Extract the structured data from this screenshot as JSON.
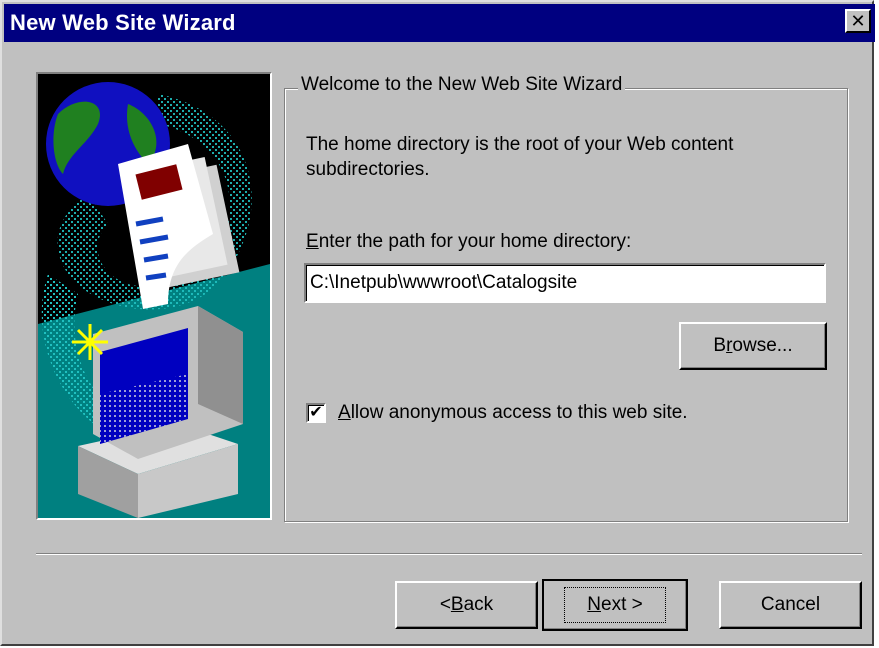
{
  "window": {
    "title": "New Web Site Wizard",
    "close_glyph": "✕"
  },
  "group": {
    "title": "Welcome to the New Web Site Wizard",
    "description": "The home directory is the root of your Web content subdirectories."
  },
  "path": {
    "label_accel": "E",
    "label_rest": "nter the path for your home directory:",
    "value": "C:\\Inetpub\\wwwroot\\Catalogsite"
  },
  "browse_button": {
    "pre": "B",
    "accel": "r",
    "post": "owse..."
  },
  "anonymous_access": {
    "checked": true,
    "check_glyph": "✔",
    "accel": "A",
    "rest": "llow anonymous access to this web site."
  },
  "buttons": {
    "back_prefix": "< ",
    "back_accel": "B",
    "back_rest": "ack",
    "next_accel": "N",
    "next_rest": "ext >",
    "cancel": "Cancel"
  },
  "illustration": {
    "icon": "wizard-computer-globe-document-illustration",
    "colors": {
      "background": "#000000",
      "globe": "#1010c0",
      "land": "#208020",
      "sparkle": "#20c0c0",
      "document": "#ffffff",
      "document_header": "#800000",
      "monitor": "#c0c0c0",
      "screen": "#0000c0",
      "star": "#ffff00",
      "floor": "#008080"
    }
  }
}
